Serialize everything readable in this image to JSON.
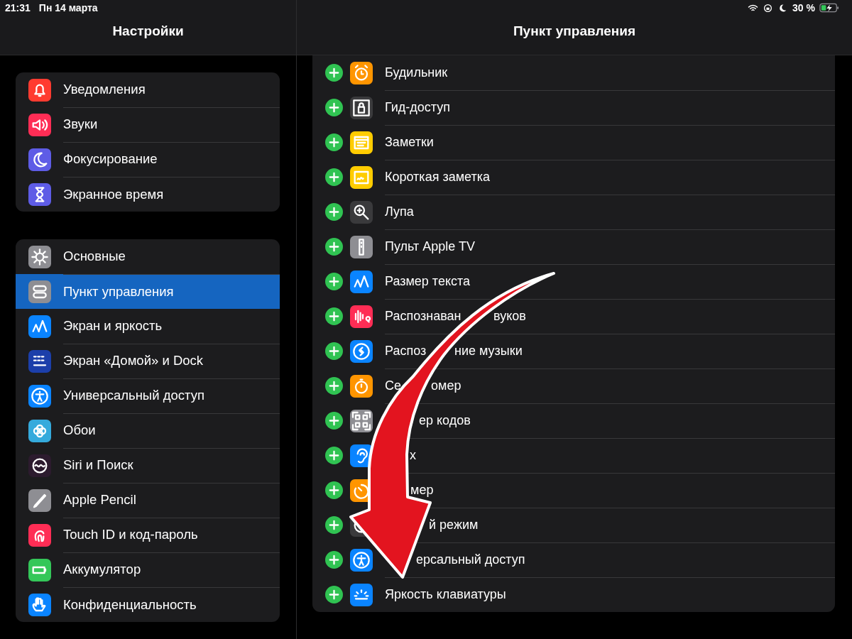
{
  "status_bar": {
    "time": "21:31",
    "date": "Пн 14 марта",
    "battery": "30 %"
  },
  "sidebar": {
    "title": "Настройки",
    "groups": [
      [
        {
          "label": "Уведомления",
          "kind": "bell",
          "color": "#ff3b30",
          "selected": false
        },
        {
          "label": "Звуки",
          "kind": "speaker",
          "color": "#ff2d55",
          "selected": false
        },
        {
          "label": "Фокусирование",
          "kind": "moon",
          "color": "#5e5ce6",
          "selected": false
        },
        {
          "label": "Экранное время",
          "kind": "hourglass",
          "color": "#5e5ce6",
          "selected": false
        }
      ],
      [
        {
          "label": "Основные",
          "kind": "gear",
          "color": "#8e8e93",
          "selected": false
        },
        {
          "label": "Пункт управления",
          "kind": "toggles",
          "color": "#8e8e93",
          "selected": true
        },
        {
          "label": "Экран и яркость",
          "kind": "textsize",
          "color": "#0a84ff",
          "selected": false
        },
        {
          "label": "Экран «Домой» и Dock",
          "kind": "grid",
          "color": "#1c3faa",
          "selected": false
        },
        {
          "label": "Универсальный доступ",
          "kind": "accessibility",
          "color": "#0a84ff",
          "selected": false
        },
        {
          "label": "Обои",
          "kind": "flower",
          "color": "#35aadc",
          "selected": false
        },
        {
          "label": "Siri и Поиск",
          "kind": "siri",
          "color": "#2c1b2e",
          "selected": false
        },
        {
          "label": "Apple Pencil",
          "kind": "pencil",
          "color": "#8e8e93",
          "selected": false
        },
        {
          "label": "Touch ID и код-пароль",
          "kind": "fingerprint",
          "color": "#ff2d55",
          "selected": false
        },
        {
          "label": "Аккумулятор",
          "kind": "battery",
          "color": "#34c759",
          "selected": false
        },
        {
          "label": "Конфиденциальность",
          "kind": "hand",
          "color": "#0a84ff",
          "selected": false
        }
      ]
    ]
  },
  "detail": {
    "title": "Пункт управления",
    "controls": [
      {
        "label_parts": [
          "Будильник"
        ],
        "kind": "alarm",
        "color": "#ff9500"
      },
      {
        "label_parts": [
          "Гид-доступ"
        ],
        "kind": "lock",
        "color": "#3a3a3c"
      },
      {
        "label_parts": [
          "Заметки"
        ],
        "kind": "notes",
        "color": "#ffcc00"
      },
      {
        "label_parts": [
          "Короткая заметка"
        ],
        "kind": "quicknote",
        "color": "#ffcc00"
      },
      {
        "label_parts": [
          "Лупа"
        ],
        "kind": "magnifier",
        "color": "#3a3a3c"
      },
      {
        "label_parts": [
          "Пульт Apple TV"
        ],
        "kind": "remote",
        "color": "#8e8e93"
      },
      {
        "label_parts": [
          "Размер текста"
        ],
        "kind": "textsize",
        "color": "#0a84ff"
      },
      {
        "label_parts": [
          "Распознаван",
          "вуков"
        ],
        "kind": "soundwave",
        "color": "#ff2d55"
      },
      {
        "label_parts": [
          "Распоз",
          "ние музыки"
        ],
        "kind": "shazam",
        "color": "#0a84ff"
      },
      {
        "label_parts": [
          "Се",
          "омер"
        ],
        "kind": "stopwatch",
        "color": "#ff9500"
      },
      {
        "label_parts": [
          "ер кодов"
        ],
        "kind": "qrcode",
        "color": "#8e8e93"
      },
      {
        "label_parts": [
          "х"
        ],
        "kind": "ear",
        "color": "#0a84ff"
      },
      {
        "label_parts": [
          "мер"
        ],
        "kind": "timer",
        "color": "#ff9500"
      },
      {
        "label_parts": [
          "й режим"
        ],
        "kind": "darkmode",
        "color": "#3a3a3c"
      },
      {
        "label_parts": [
          "ерсальный доступ"
        ],
        "kind": "accessibility",
        "color": "#0a84ff"
      },
      {
        "label_parts": [
          "Яркость клавиатуры"
        ],
        "kind": "keyboardlight",
        "color": "#0a84ff"
      }
    ]
  }
}
